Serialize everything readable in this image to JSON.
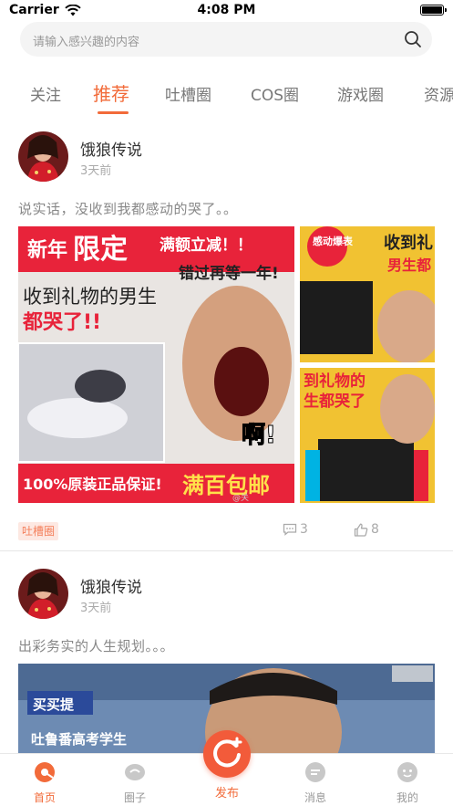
{
  "status_bar": {
    "carrier": "Carrier",
    "time": "4:08 PM"
  },
  "search": {
    "placeholder": "请输入感兴趣的内容"
  },
  "tabs": [
    {
      "label": "关注"
    },
    {
      "label": "推荐",
      "active": true
    },
    {
      "label": "吐槽圈"
    },
    {
      "label": "COS圈"
    },
    {
      "label": "游戏圈"
    },
    {
      "label": "资源"
    }
  ],
  "posts": [
    {
      "author": "饿狼传说",
      "time": "3天前",
      "text": "说实话，没收到我都感动的哭了。。",
      "images": [
        {
          "texts": [
            "新年",
            "限定",
            "满额立减！！",
            "错过再等一年!",
            "收到礼物的男生",
            "都哭了!!",
            "啊!",
            "100%原装正品保证!",
            "满百包邮",
            "@关"
          ]
        },
        {
          "texts": [
            "感动爆表",
            "收到礼",
            "男生都"
          ]
        },
        {
          "texts": [
            "到礼物的",
            "生都哭了"
          ]
        }
      ],
      "tag": "吐槽圈",
      "comments": "3",
      "likes": "8"
    },
    {
      "author": "饿狼传说",
      "time": "3天前",
      "text": "出彩务实的人生规划。。。",
      "images": [
        {
          "texts": [
            "买买提",
            "吐鲁番高考学生"
          ]
        }
      ]
    }
  ],
  "tabbar": {
    "items": [
      {
        "label": "首页",
        "active": true
      },
      {
        "label": "圈子"
      },
      {
        "label": "发布"
      },
      {
        "label": "消息"
      },
      {
        "label": "我的"
      }
    ]
  },
  "colors": {
    "accent": "#f26b3a",
    "tag_bg": "#fde8e2",
    "tag_text": "#f4805c"
  }
}
